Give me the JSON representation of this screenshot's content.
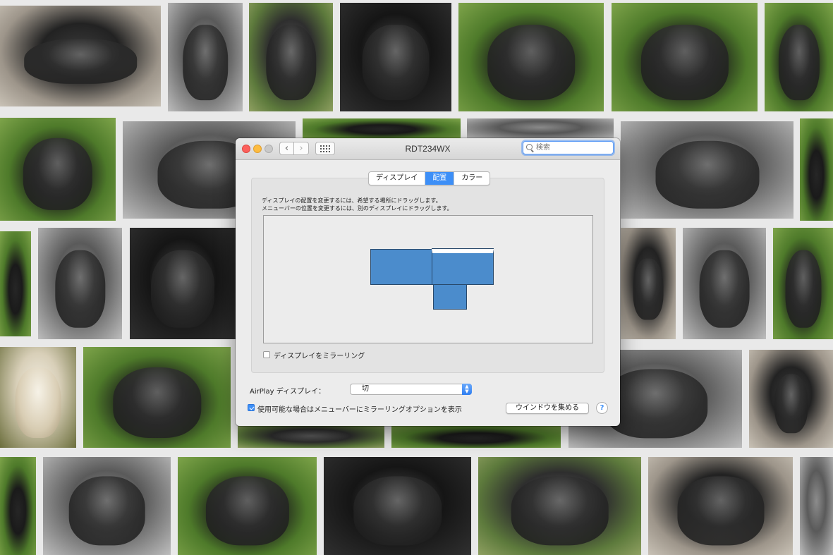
{
  "window": {
    "title": "RDT234WX",
    "search_placeholder": "検索"
  },
  "tabs": [
    {
      "label": "ディスプレイ",
      "active": false
    },
    {
      "label": "配置",
      "active": true
    },
    {
      "label": "カラー",
      "active": false
    }
  ],
  "arrangement": {
    "instruction_line1": "ディスプレイの配置を変更するには、希望する場所にドラッグします。",
    "instruction_line2": "メニューバーの位置を変更するには、別のディスプレイにドラッグします。"
  },
  "mirror": {
    "label": "ディスプレイをミラーリング",
    "checked": false
  },
  "airplay": {
    "label": "AirPlay ディスプレイ：",
    "value": "切"
  },
  "show_mirroring_option": {
    "label": "使用可能な場合はメニューバーにミラーリングオプションを表示",
    "checked": true
  },
  "gather_windows_button": "ウインドウを集める",
  "help_button": "?",
  "icons": {
    "back": "‹",
    "forward": "›"
  },
  "colors": {
    "accent": "#3d8ff7",
    "display_fill": "#4b8ccc"
  }
}
